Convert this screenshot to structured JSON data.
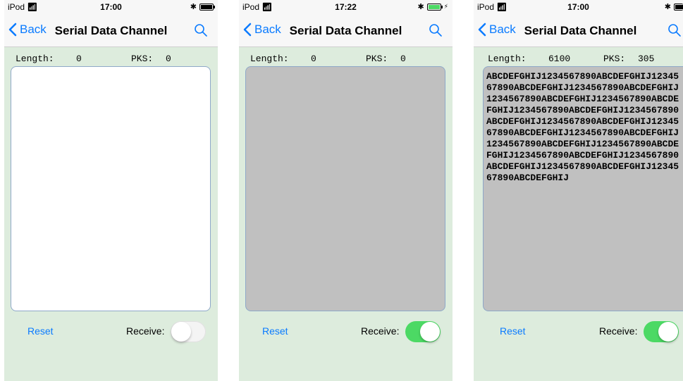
{
  "screens": [
    {
      "status": {
        "carrier": "iPod",
        "time": "17:00"
      },
      "nav": {
        "back": "Back",
        "title": "Serial Data Channel"
      },
      "stats": {
        "length_label": "Length:",
        "length_value": "0",
        "pks_label": "PKS:",
        "pks_value": "0"
      },
      "data_text": "",
      "receive": {
        "reset": "Reset",
        "label": "Receive:",
        "on": false
      }
    },
    {
      "status": {
        "carrier": "iPod",
        "time": "17:22"
      },
      "nav": {
        "back": "Back",
        "title": "Serial Data Channel"
      },
      "stats": {
        "length_label": "Length:",
        "length_value": "0",
        "pks_label": "PKS:",
        "pks_value": "0"
      },
      "data_text": "",
      "receive": {
        "reset": "Reset",
        "label": "Receive:",
        "on": true
      }
    },
    {
      "status": {
        "carrier": "iPod",
        "time": "17:00"
      },
      "nav": {
        "back": "Back",
        "title": "Serial Data Channel"
      },
      "stats": {
        "length_label": "Length:",
        "length_value": "6100",
        "pks_label": "PKS:",
        "pks_value": "305"
      },
      "data_text": "ABCDEFGHIJ1234567890ABCDEFGHIJ1234567890ABCDEFGHIJ1234567890ABCDEFGHIJ1234567890ABCDEFGHIJ1234567890ABCDEFGHIJ1234567890ABCDEFGHIJ1234567890ABCDEFGHIJ1234567890ABCDEFGHIJ1234567890ABCDEFGHIJ1234567890ABCDEFGHIJ1234567890ABCDEFGHIJ1234567890ABCDEFGHIJ1234567890ABCDEFGHIJ1234567890ABCDEFGHIJ1234567890ABCDEFGHIJ1234567890ABCDEFGHIJ",
      "receive": {
        "reset": "Reset",
        "label": "Receive:",
        "on": true
      }
    }
  ],
  "colors": {
    "accent": "#0a7bff",
    "toggle_on": "#4cd964",
    "background": "#ddecdd",
    "data_area_gray": "#c0c0c0"
  },
  "icons": {
    "back": "chevron-left-icon",
    "search": "search-icon",
    "wifi": "wifi-icon",
    "bluetooth": "bluetooth-icon",
    "battery": "battery-icon"
  }
}
